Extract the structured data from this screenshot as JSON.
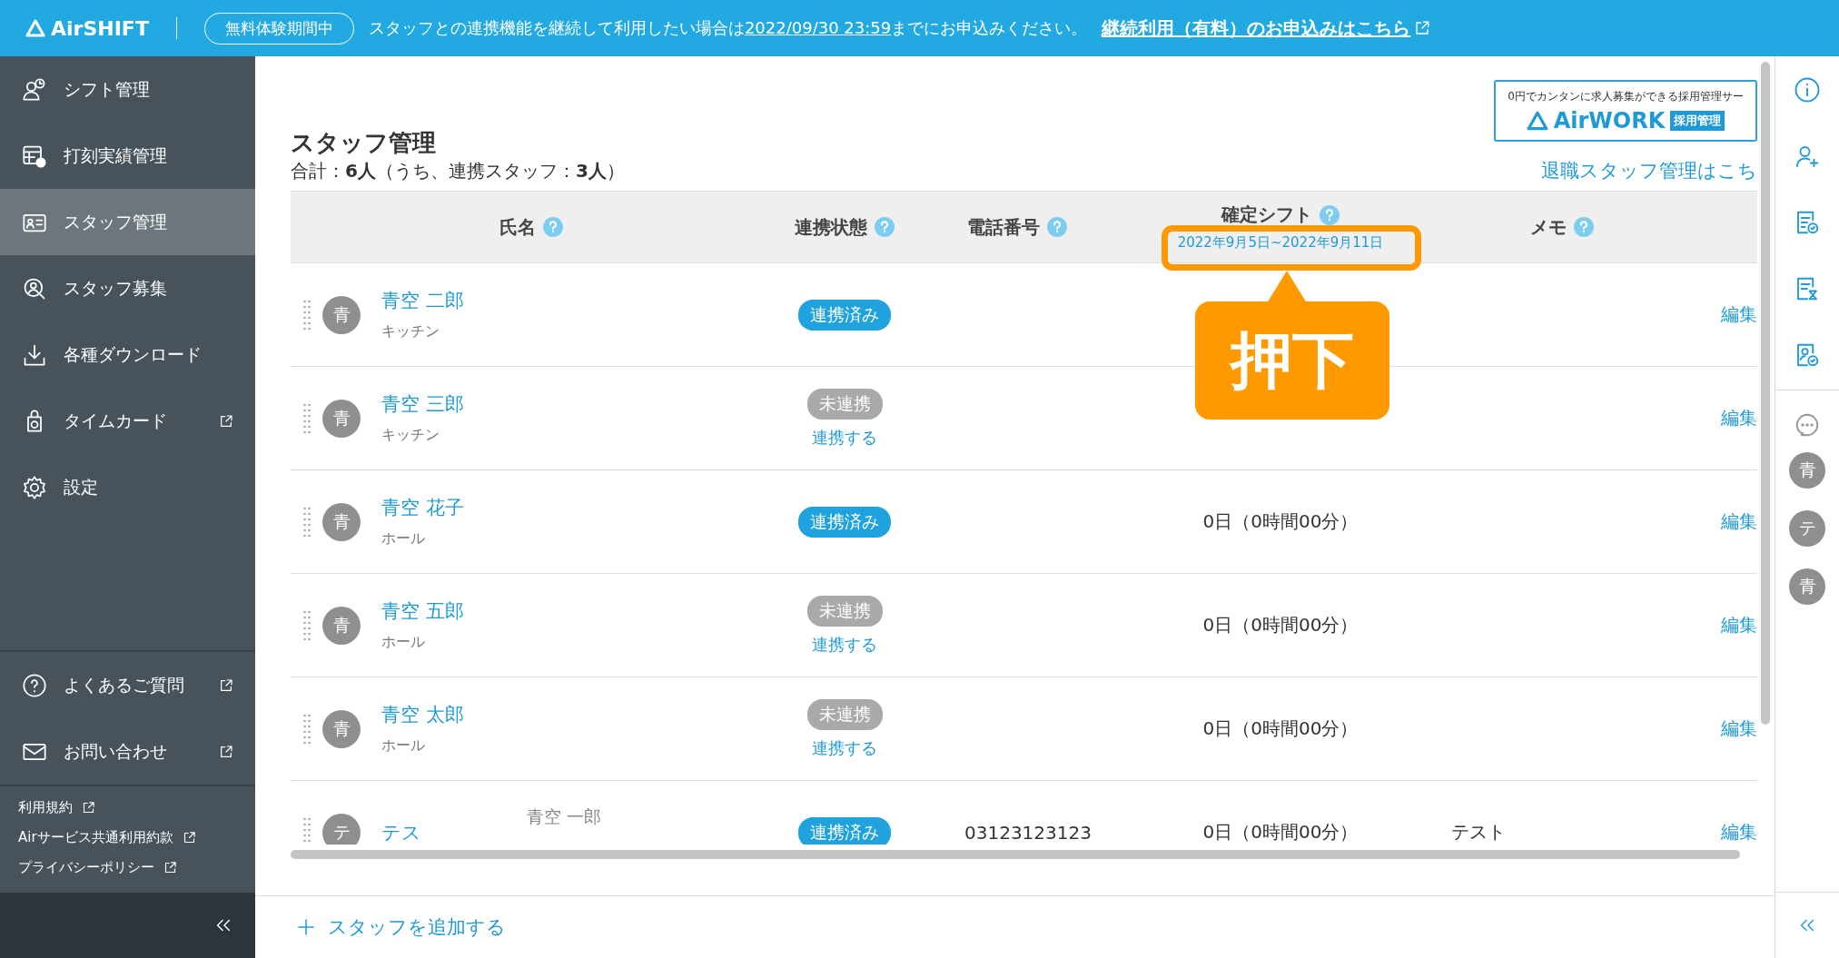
{
  "top_bar": {
    "logo": "AirSHIFT",
    "trial_badge": "無料体験期間中",
    "notice": "スタッフとの連携機能を継続して利用したい場合は",
    "deadline": "2022/09/30 23:59",
    "notice_end": "までにお申込みください。",
    "cta_link": "継続利用（有料）のお申込みはこちら"
  },
  "sidebar": {
    "items": [
      {
        "label": "シフト管理",
        "selected": false,
        "external": false
      },
      {
        "label": "打刻実績管理",
        "selected": false,
        "external": false
      },
      {
        "label": "スタッフ管理",
        "selected": true,
        "external": false
      },
      {
        "label": "スタッフ募集",
        "selected": false,
        "external": false
      },
      {
        "label": "各種ダウンロード",
        "selected": false,
        "external": false
      },
      {
        "label": "タイムカード",
        "selected": false,
        "external": true
      },
      {
        "label": "設定",
        "selected": false,
        "external": false
      }
    ],
    "help_items": [
      {
        "label": "よくあるご質問",
        "external": true
      },
      {
        "label": "お問い合わせ",
        "external": true
      }
    ],
    "footer_links": [
      "利用規約",
      "Airサービス共通利用約款",
      "プライバシーポリシー"
    ]
  },
  "page": {
    "title": "スタッフ管理",
    "summary": "合計：**6人**（うち、連携スタッフ：**3人**）",
    "retired_link": "退職スタッフ管理はこち",
    "ad": {
      "caption": "0円でカンタンに求人募集ができる採用管理サー",
      "logo": "AirWORK",
      "badge": "採用管理"
    }
  },
  "table": {
    "columns": [
      {
        "label": "氏名"
      },
      {
        "label": "連携状態"
      },
      {
        "label": "電話番号"
      },
      {
        "label": "確定シフト",
        "sub": "2022年9月5日~2022年9月11日"
      },
      {
        "label": "メモ"
      }
    ],
    "rows": [
      {
        "avatar": "青",
        "name": "青空 二郎",
        "role": "キッチン",
        "linked": true,
        "status": "連携済み",
        "edit": "編集"
      },
      {
        "avatar": "青",
        "name": "青空 三郎",
        "role": "キッチン",
        "linked": false,
        "status": "未連携",
        "link_action": "連携する",
        "edit": "編集"
      },
      {
        "avatar": "青",
        "name": "青空 花子",
        "role": "ホール",
        "linked": true,
        "status": "連携済み",
        "shift": "0日（0時間00分）",
        "edit": "編集"
      },
      {
        "avatar": "青",
        "name": "青空 五郎",
        "role": "ホール",
        "linked": false,
        "status": "未連携",
        "link_action": "連携する",
        "shift": "0日（0時間00分）",
        "edit": "編集"
      },
      {
        "avatar": "青",
        "name": "青空 太郎",
        "role": "ホール",
        "linked": false,
        "status": "未連携",
        "link_action": "連携する",
        "shift": "0日（0時間00分）",
        "edit": "編集"
      },
      {
        "avatar": "テ",
        "name": "テス",
        "alias": "青空 一郎",
        "linked": true,
        "status": "連携済み",
        "phone": "03123123123",
        "shift": "0日（0時間00分）",
        "memo": "テスト",
        "edit": "編集"
      }
    ]
  },
  "add_button": "スタッフを追加する",
  "callout": {
    "text": "押下"
  },
  "right_rail": {
    "avatars": [
      "青",
      "テ",
      "青"
    ]
  }
}
